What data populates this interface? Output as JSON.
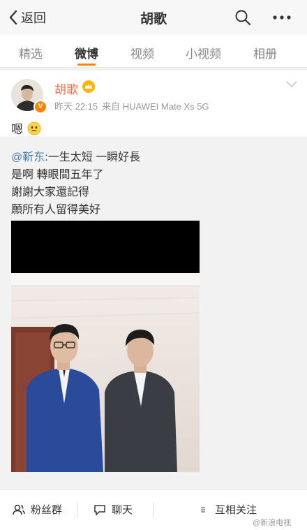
{
  "header": {
    "back_label": "返回",
    "title": "胡歌"
  },
  "tabs": [
    {
      "label": "精选"
    },
    {
      "label": "微博"
    },
    {
      "label": "视频"
    },
    {
      "label": "小视频"
    },
    {
      "label": "相册"
    }
  ],
  "post": {
    "author": "胡歌",
    "time": "昨天 22:15",
    "source": "来自 HUAWEI Mate Xs 5G",
    "text": "嗯"
  },
  "quote": {
    "mention": "@靳东",
    "first_line": ":一生太短 一瞬好長",
    "lines": [
      "是啊 轉眼間五年了",
      "謝謝大家還記得",
      "願所有人留得美好"
    ]
  },
  "bottom_bar": {
    "fans_group": "粉丝群",
    "chat": "聊天",
    "mutual_follow": "互相关注"
  },
  "watermark": "@新浪电视",
  "colors": {
    "accent": "#ff8200",
    "author_name": "#eb7350",
    "mention": "#507daf"
  },
  "icons": [
    "chevron-left-icon",
    "search-icon",
    "more-icon",
    "crown-icon",
    "verified-badge-icon",
    "chevron-down-icon",
    "fans-group-icon",
    "chat-icon",
    "menu-icon"
  ]
}
